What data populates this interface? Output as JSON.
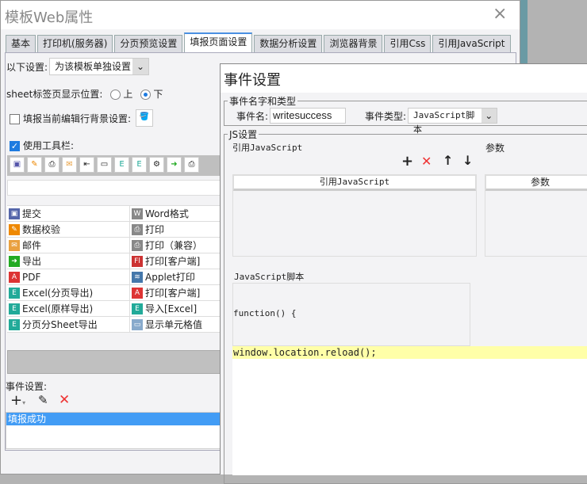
{
  "main": {
    "title": "模板Web属性",
    "close": "×",
    "tabs": [
      "基本",
      "打印机(服务器)",
      "分页预览设置",
      "填报页面设置",
      "数据分析设置",
      "浏览器背景",
      "引用Css",
      "引用JavaScript"
    ],
    "settings_label": "以下设置:",
    "settings_value": "为该模板单独设置",
    "sheet_pos_label": "sheet标签页显示位置:",
    "pos_up": "上",
    "pos_down": "下",
    "bg_label": "填报当前编辑行背景设置:",
    "toolbar_label": "使用工具栏:",
    "buttons": [
      [
        "提交",
        "Word格式"
      ],
      [
        "数据校验",
        "打印"
      ],
      [
        "邮件",
        "打印（兼容）"
      ],
      [
        "导出",
        "打印[客户端]"
      ],
      [
        "PDF",
        "Applet打印"
      ],
      [
        "Excel(分页导出)",
        "打印[客户端]"
      ],
      [
        "Excel(原样导出)",
        "导入[Excel]"
      ],
      [
        "分页分Sheet导出",
        "显示单元格值"
      ]
    ],
    "event_label": "事件设置:",
    "events": [
      "填报成功"
    ]
  },
  "event_dialog": {
    "title": "事件设置",
    "name_group": "事件名字和类型",
    "name_label": "事件名:",
    "name_value": "writesuccess",
    "type_label": "事件类型:",
    "type_value": "JavaScript脚本",
    "js_group": "JS设置",
    "ref_js": "引用JavaScript",
    "params": "参数",
    "col_ref_js": "引用JavaScript",
    "col_params": "参数",
    "script_group": "JavaScript脚本",
    "code_line1": "function() {",
    "code_line2": "window.location.reload();"
  }
}
